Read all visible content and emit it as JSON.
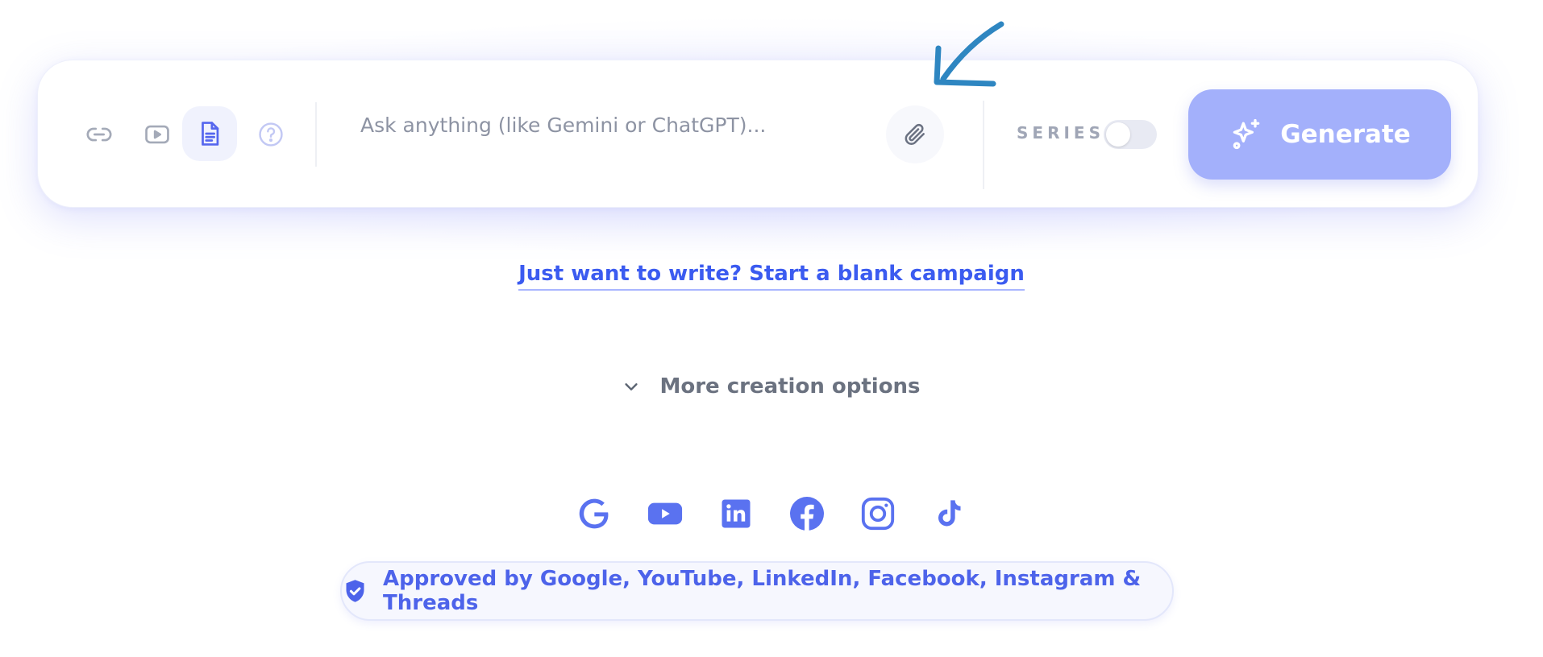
{
  "prompt_bar": {
    "source_buttons": [
      {
        "name": "link-icon"
      },
      {
        "name": "video-icon"
      },
      {
        "name": "document-icon",
        "active": true
      },
      {
        "name": "help-icon"
      }
    ],
    "input_placeholder": "Ask anything (like Gemini or ChatGPT)...",
    "input_value": "",
    "attach_icon": "paperclip-icon",
    "series_label": "SERIES",
    "series_enabled": false,
    "generate_label": "Generate",
    "generate_icon": "sparkles-icon"
  },
  "blank_campaign": {
    "prefix": "Just want to write? ",
    "link": "Start a blank campaign"
  },
  "more_options": {
    "label": "More creation options",
    "icon": "chevron-down-icon"
  },
  "socials": [
    "google-icon",
    "youtube-icon",
    "linkedin-icon",
    "facebook-icon",
    "instagram-icon",
    "tiktok-icon"
  ],
  "approved": {
    "icon": "shield-check-icon",
    "text": "Approved by Google, YouTube, LinkedIn, Facebook, Instagram & Threads"
  },
  "colors": {
    "accent": "#4d63ea",
    "link": "#3b5bf0",
    "generate_bg": "#a3b0fb",
    "annotation_arrow": "#2e86c1"
  }
}
